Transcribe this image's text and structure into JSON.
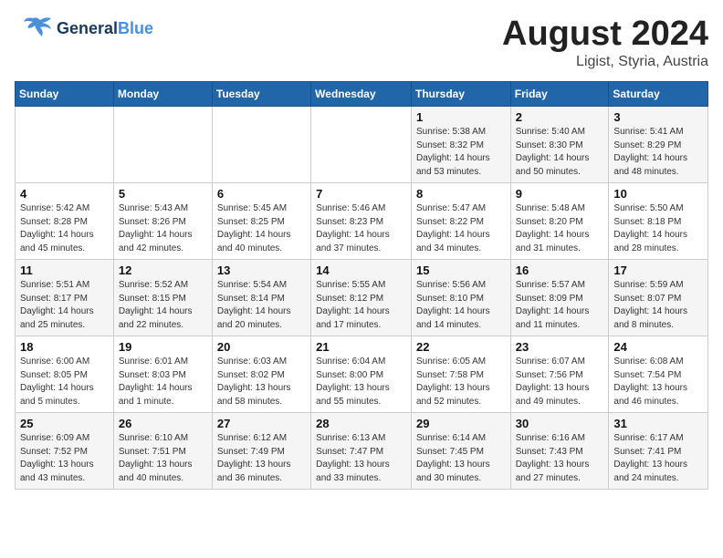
{
  "header": {
    "logo_general": "General",
    "logo_blue": "Blue",
    "month_title": "August 2024",
    "subtitle": "Ligist, Styria, Austria"
  },
  "days_of_week": [
    "Sunday",
    "Monday",
    "Tuesday",
    "Wednesday",
    "Thursday",
    "Friday",
    "Saturday"
  ],
  "weeks": [
    [
      {
        "day": "",
        "sunrise": "",
        "sunset": "",
        "daylight": ""
      },
      {
        "day": "",
        "sunrise": "",
        "sunset": "",
        "daylight": ""
      },
      {
        "day": "",
        "sunrise": "",
        "sunset": "",
        "daylight": ""
      },
      {
        "day": "",
        "sunrise": "",
        "sunset": "",
        "daylight": ""
      },
      {
        "day": "1",
        "sunrise": "Sunrise: 5:38 AM",
        "sunset": "Sunset: 8:32 PM",
        "daylight": "Daylight: 14 hours and 53 minutes."
      },
      {
        "day": "2",
        "sunrise": "Sunrise: 5:40 AM",
        "sunset": "Sunset: 8:30 PM",
        "daylight": "Daylight: 14 hours and 50 minutes."
      },
      {
        "day": "3",
        "sunrise": "Sunrise: 5:41 AM",
        "sunset": "Sunset: 8:29 PM",
        "daylight": "Daylight: 14 hours and 48 minutes."
      }
    ],
    [
      {
        "day": "4",
        "sunrise": "Sunrise: 5:42 AM",
        "sunset": "Sunset: 8:28 PM",
        "daylight": "Daylight: 14 hours and 45 minutes."
      },
      {
        "day": "5",
        "sunrise": "Sunrise: 5:43 AM",
        "sunset": "Sunset: 8:26 PM",
        "daylight": "Daylight: 14 hours and 42 minutes."
      },
      {
        "day": "6",
        "sunrise": "Sunrise: 5:45 AM",
        "sunset": "Sunset: 8:25 PM",
        "daylight": "Daylight: 14 hours and 40 minutes."
      },
      {
        "day": "7",
        "sunrise": "Sunrise: 5:46 AM",
        "sunset": "Sunset: 8:23 PM",
        "daylight": "Daylight: 14 hours and 37 minutes."
      },
      {
        "day": "8",
        "sunrise": "Sunrise: 5:47 AM",
        "sunset": "Sunset: 8:22 PM",
        "daylight": "Daylight: 14 hours and 34 minutes."
      },
      {
        "day": "9",
        "sunrise": "Sunrise: 5:48 AM",
        "sunset": "Sunset: 8:20 PM",
        "daylight": "Daylight: 14 hours and 31 minutes."
      },
      {
        "day": "10",
        "sunrise": "Sunrise: 5:50 AM",
        "sunset": "Sunset: 8:18 PM",
        "daylight": "Daylight: 14 hours and 28 minutes."
      }
    ],
    [
      {
        "day": "11",
        "sunrise": "Sunrise: 5:51 AM",
        "sunset": "Sunset: 8:17 PM",
        "daylight": "Daylight: 14 hours and 25 minutes."
      },
      {
        "day": "12",
        "sunrise": "Sunrise: 5:52 AM",
        "sunset": "Sunset: 8:15 PM",
        "daylight": "Daylight: 14 hours and 22 minutes."
      },
      {
        "day": "13",
        "sunrise": "Sunrise: 5:54 AM",
        "sunset": "Sunset: 8:14 PM",
        "daylight": "Daylight: 14 hours and 20 minutes."
      },
      {
        "day": "14",
        "sunrise": "Sunrise: 5:55 AM",
        "sunset": "Sunset: 8:12 PM",
        "daylight": "Daylight: 14 hours and 17 minutes."
      },
      {
        "day": "15",
        "sunrise": "Sunrise: 5:56 AM",
        "sunset": "Sunset: 8:10 PM",
        "daylight": "Daylight: 14 hours and 14 minutes."
      },
      {
        "day": "16",
        "sunrise": "Sunrise: 5:57 AM",
        "sunset": "Sunset: 8:09 PM",
        "daylight": "Daylight: 14 hours and 11 minutes."
      },
      {
        "day": "17",
        "sunrise": "Sunrise: 5:59 AM",
        "sunset": "Sunset: 8:07 PM",
        "daylight": "Daylight: 14 hours and 8 minutes."
      }
    ],
    [
      {
        "day": "18",
        "sunrise": "Sunrise: 6:00 AM",
        "sunset": "Sunset: 8:05 PM",
        "daylight": "Daylight: 14 hours and 5 minutes."
      },
      {
        "day": "19",
        "sunrise": "Sunrise: 6:01 AM",
        "sunset": "Sunset: 8:03 PM",
        "daylight": "Daylight: 14 hours and 1 minute."
      },
      {
        "day": "20",
        "sunrise": "Sunrise: 6:03 AM",
        "sunset": "Sunset: 8:02 PM",
        "daylight": "Daylight: 13 hours and 58 minutes."
      },
      {
        "day": "21",
        "sunrise": "Sunrise: 6:04 AM",
        "sunset": "Sunset: 8:00 PM",
        "daylight": "Daylight: 13 hours and 55 minutes."
      },
      {
        "day": "22",
        "sunrise": "Sunrise: 6:05 AM",
        "sunset": "Sunset: 7:58 PM",
        "daylight": "Daylight: 13 hours and 52 minutes."
      },
      {
        "day": "23",
        "sunrise": "Sunrise: 6:07 AM",
        "sunset": "Sunset: 7:56 PM",
        "daylight": "Daylight: 13 hours and 49 minutes."
      },
      {
        "day": "24",
        "sunrise": "Sunrise: 6:08 AM",
        "sunset": "Sunset: 7:54 PM",
        "daylight": "Daylight: 13 hours and 46 minutes."
      }
    ],
    [
      {
        "day": "25",
        "sunrise": "Sunrise: 6:09 AM",
        "sunset": "Sunset: 7:52 PM",
        "daylight": "Daylight: 13 hours and 43 minutes."
      },
      {
        "day": "26",
        "sunrise": "Sunrise: 6:10 AM",
        "sunset": "Sunset: 7:51 PM",
        "daylight": "Daylight: 13 hours and 40 minutes."
      },
      {
        "day": "27",
        "sunrise": "Sunrise: 6:12 AM",
        "sunset": "Sunset: 7:49 PM",
        "daylight": "Daylight: 13 hours and 36 minutes."
      },
      {
        "day": "28",
        "sunrise": "Sunrise: 6:13 AM",
        "sunset": "Sunset: 7:47 PM",
        "daylight": "Daylight: 13 hours and 33 minutes."
      },
      {
        "day": "29",
        "sunrise": "Sunrise: 6:14 AM",
        "sunset": "Sunset: 7:45 PM",
        "daylight": "Daylight: 13 hours and 30 minutes."
      },
      {
        "day": "30",
        "sunrise": "Sunrise: 6:16 AM",
        "sunset": "Sunset: 7:43 PM",
        "daylight": "Daylight: 13 hours and 27 minutes."
      },
      {
        "day": "31",
        "sunrise": "Sunrise: 6:17 AM",
        "sunset": "Sunset: 7:41 PM",
        "daylight": "Daylight: 13 hours and 24 minutes."
      }
    ]
  ]
}
